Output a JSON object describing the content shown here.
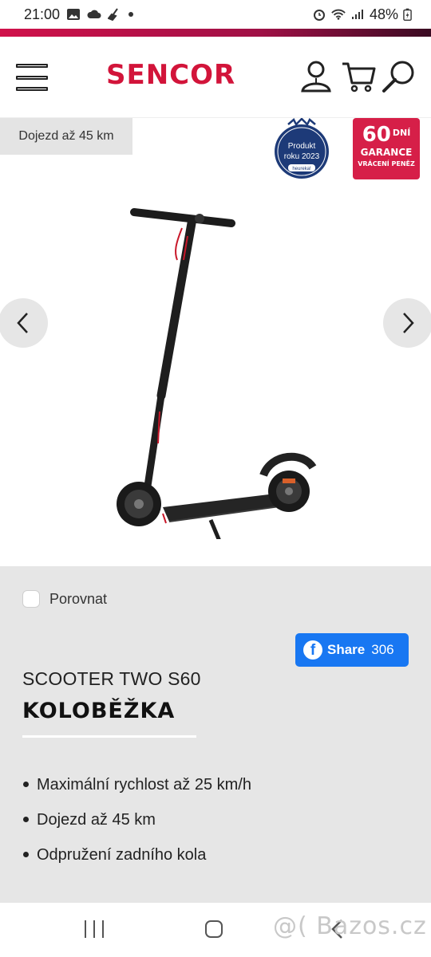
{
  "status_bar": {
    "time": "21:00",
    "battery": "48%"
  },
  "header": {
    "brand": "SENCOR",
    "icons": [
      "menu-icon",
      "user-location-icon",
      "cart-icon",
      "search-icon"
    ]
  },
  "hero": {
    "range_tag": "Dojezd až 45 km",
    "badge_heureka": {
      "line1": "Produkt",
      "line2": "roku 2023",
      "source": "heureka!"
    },
    "badge_garance": {
      "number": "60",
      "days": "DNÍ",
      "title": "GARANCE",
      "subtitle": "VRÁCENÍ PENĚZ"
    }
  },
  "product": {
    "compare_label": "Porovnat",
    "share": {
      "label": "Share",
      "count": "306"
    },
    "model": "SCOOTER TWO S60",
    "category": "KOLOBĚŽKA",
    "features": [
      "Maximální rychlost až 25 km/h",
      "Dojezd až 45 km",
      "Odpružení zadního kola"
    ]
  },
  "watermark": "@( Bazos.cz",
  "colors": {
    "brand": "#d2143a",
    "facebook": "#1877f2",
    "info_bg": "#e6e6e6"
  }
}
